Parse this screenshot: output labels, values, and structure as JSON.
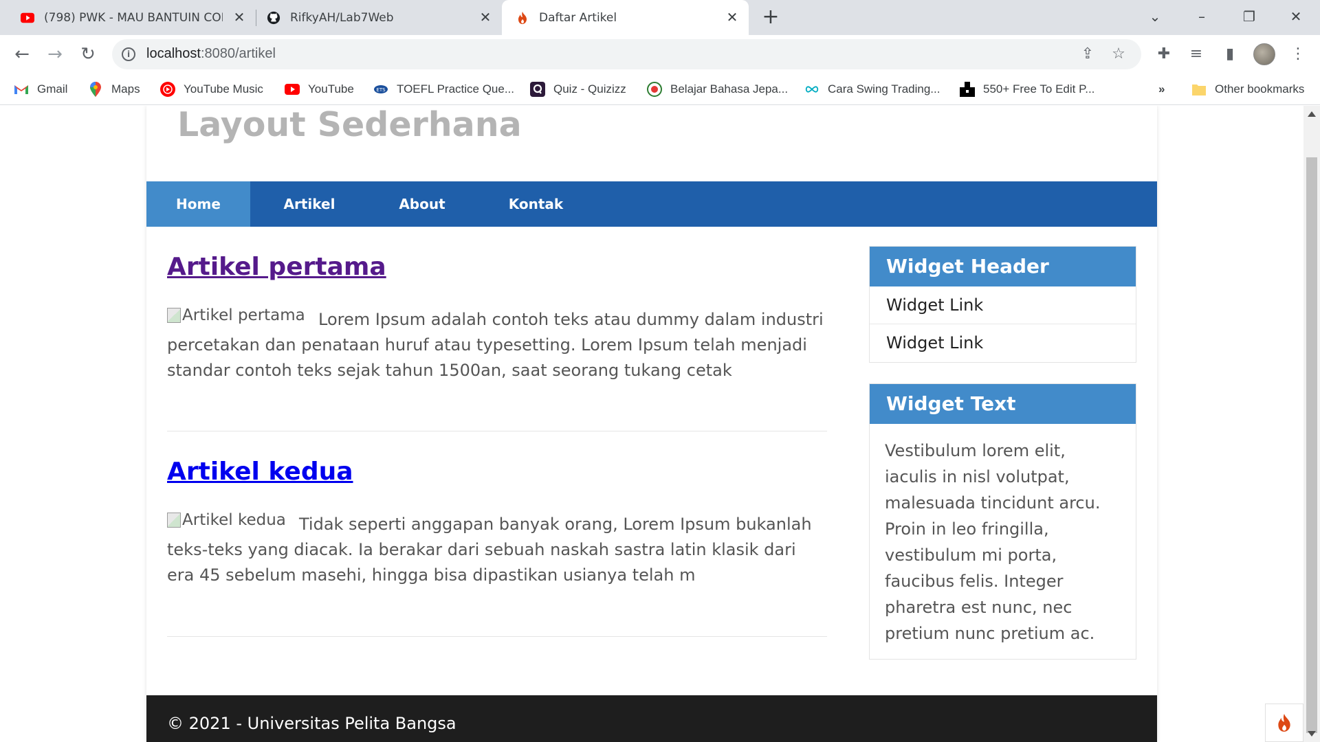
{
  "tabs": [
    {
      "title": "(798) PWK - MAU BANTUIN COM",
      "icon": "youtube-icon",
      "active": false
    },
    {
      "title": "RifkyAH/Lab7Web",
      "icon": "github-icon",
      "active": false
    },
    {
      "title": "Daftar Artikel",
      "icon": "codeigniter-flame-icon",
      "active": true
    }
  ],
  "address_bar": {
    "url_host": "localhost",
    "url_path": ":8080/artikel"
  },
  "bookmarks": [
    {
      "label": "Gmail",
      "icon": "gmail-icon"
    },
    {
      "label": "Maps",
      "icon": "maps-pin-icon"
    },
    {
      "label": "YouTube Music",
      "icon": "youtube-music-icon"
    },
    {
      "label": "YouTube",
      "icon": "youtube-icon"
    },
    {
      "label": "TOEFL Practice Que...",
      "icon": "ets-icon"
    },
    {
      "label": "Quiz - Quizizz",
      "icon": "quizizz-icon"
    },
    {
      "label": "Belajar Bahasa Jepa...",
      "icon": "language-icon"
    },
    {
      "label": "Cara Swing Trading...",
      "icon": "infinity-icon"
    },
    {
      "label": "550+ Free To Edit P...",
      "icon": "picsart-icon"
    }
  ],
  "bookmarks_more": "»",
  "other_bookmarks": "Other bookmarks",
  "site": {
    "title": "Layout Sederhana",
    "nav": [
      "Home",
      "Artikel",
      "About",
      "Kontak"
    ],
    "articles": [
      {
        "title": "Artikel pertama",
        "img_alt": "Artikel pertama",
        "body": "Lorem Ipsum adalah contoh teks atau dummy dalam industri percetakan dan penataan huruf atau typesetting. Lorem Ipsum telah menjadi standar contoh teks sejak tahun 1500an, saat seorang tukang cetak",
        "visited": true
      },
      {
        "title": "Artikel kedua",
        "img_alt": "Artikel kedua",
        "body": "Tidak seperti anggapan banyak orang, Lorem Ipsum bukanlah teks-teks yang diacak. Ia berakar dari sebuah naskah sastra latin klasik dari era 45 sebelum masehi, hingga bisa dipastikan usianya telah m",
        "visited": false
      }
    ],
    "widgets": {
      "header_title": "Widget Header",
      "links": [
        "Widget Link",
        "Widget Link"
      ],
      "text_title": "Widget Text",
      "text_body": "Vestibulum lorem elit, iaculis in nisl volutpat, malesuada tincidunt arcu. Proin in leo fringilla, vestibulum mi porta, faucibus felis. Integer pharetra est nunc, nec pretium nunc pretium ac."
    },
    "footer": "© 2021 - Universitas Pelita Bangsa"
  },
  "colors": {
    "nav_bg": "#1f5faa",
    "nav_active": "#428bca",
    "widget_header": "#428bca",
    "visited_link": "#551a8b",
    "link": "#0000ee",
    "footer_bg": "#1e1e1e"
  }
}
